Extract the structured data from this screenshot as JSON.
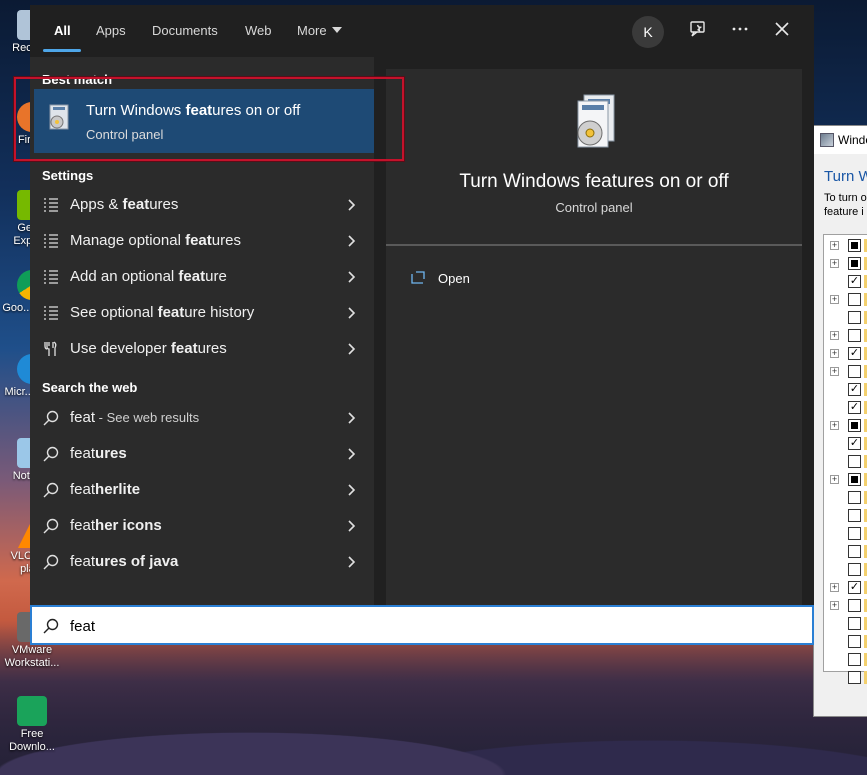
{
  "desktop": {
    "icons": [
      {
        "label": "Recyc...",
        "color": "#b0c4d8"
      },
      {
        "label": "Fire...",
        "color": "#e8742a"
      },
      {
        "label": "GeF... Exper...",
        "color": "#76b900"
      },
      {
        "label": "Goo... Chr...",
        "color": "#4285f4"
      },
      {
        "label": "Micr... Ed...",
        "color": "#1f8ad6"
      },
      {
        "label": "Notep...",
        "color": "#9bc7e8"
      },
      {
        "label": "VLC m... pla...",
        "color": "#ff8800"
      },
      {
        "label": "VMware Workstati...",
        "color": "#696969"
      },
      {
        "label": "Free Downlo...",
        "color": "#1aa35a"
      }
    ]
  },
  "background_dialog": {
    "title": "Windo",
    "heading": "Turn W",
    "description_line1": "To turn o",
    "description_line2": "feature i"
  },
  "tabs": [
    {
      "label": "All"
    },
    {
      "label": "Apps"
    },
    {
      "label": "Documents"
    },
    {
      "label": "Web"
    },
    {
      "label": "More"
    }
  ],
  "user": {
    "initial": "K"
  },
  "best_match": {
    "heading": "Best match",
    "title_pre": "Turn Windows ",
    "title_bold": "feat",
    "title_post": "ures on or off",
    "subtitle": "Control panel"
  },
  "settings": {
    "heading": "Settings",
    "items": [
      {
        "pre": "Apps & ",
        "bold": "feat",
        "post": "ures",
        "icon": "list-icon"
      },
      {
        "pre": "Manage optional ",
        "bold": "feat",
        "post": "ures",
        "icon": "list-icon"
      },
      {
        "pre": "Add an optional ",
        "bold": "feat",
        "post": "ure",
        "icon": "list-icon"
      },
      {
        "pre": "See optional ",
        "bold": "feat",
        "post": "ure history",
        "icon": "list-icon"
      },
      {
        "pre": "Use developer ",
        "bold": "feat",
        "post": "ures",
        "icon": "developer-tools-icon"
      }
    ]
  },
  "web": {
    "heading": "Search the web",
    "items": [
      {
        "main": "feat",
        "sub": " - See web results"
      },
      {
        "pre": "feat",
        "bold": "ures"
      },
      {
        "pre": "feat",
        "bold": "herlite"
      },
      {
        "pre": "feat",
        "bold": "her icons"
      },
      {
        "pre": "feat",
        "bold": "ures of java"
      }
    ]
  },
  "detail": {
    "title": "Turn Windows features on or off",
    "subtitle": "Control panel",
    "action": "Open"
  },
  "search": {
    "value": "feat"
  }
}
